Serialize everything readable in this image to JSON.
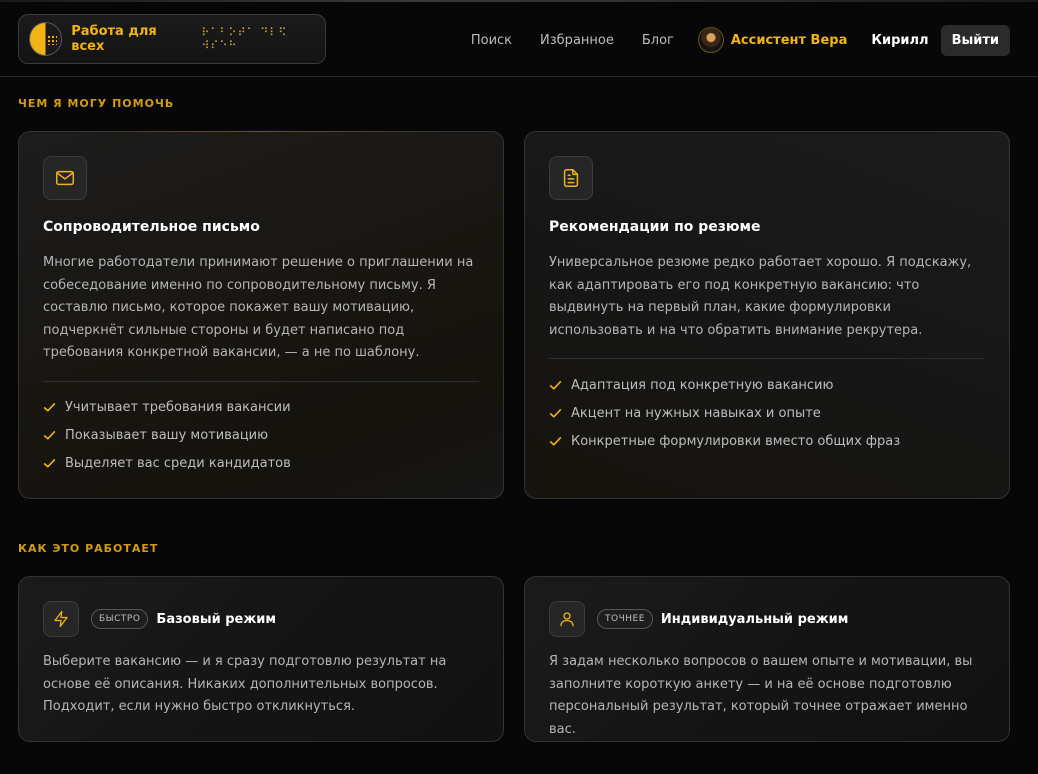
{
  "header": {
    "brand_title": "Работа для всех",
    "brand_braille": "⠗⠁⠃⠕⠞⠁ ⠙⠇⠫ ⠺⠎⠑⠓",
    "nav": [
      "Поиск",
      "Избранное",
      "Блог"
    ],
    "assistant_name": "Ассистент Вера",
    "user_name": "Кирилл",
    "logout_label": "Выйти"
  },
  "help_section": {
    "title": "ЧЕМ Я МОГУ ПОМОЧЬ",
    "cards": [
      {
        "icon": "mail-icon",
        "title": "Сопроводительное письмо",
        "text": "Многие работодатели принимают решение о приглашении на собеседование именно по сопроводительному письму. Я составлю письмо, которое покажет вашу мотивацию, подчеркнёт сильные стороны и будет написано под требования конкретной вакансии, — а не по шаблону.",
        "features": [
          "Учитывает требования вакансии",
          "Показывает вашу мотивацию",
          "Выделяет вас среди кандидатов"
        ]
      },
      {
        "icon": "document-icon",
        "title": "Рекомендации по резюме",
        "text": "Универсальное резюме редко работает хорошо. Я подскажу, как адаптировать его под конкретную вакансию: что выдвинуть на первый план, какие формулировки использовать и на что обратить внимание рекрутера.",
        "features": [
          "Адаптация под конкретную вакансию",
          "Акцент на нужных навыках и опыте",
          "Конкретные формулировки вместо общих фраз"
        ]
      }
    ]
  },
  "how_section": {
    "title": "КАК ЭТО РАБОТАЕТ",
    "modes": [
      {
        "icon": "lightning-icon",
        "badge": "БЫСТРО",
        "title": "Базовый режим",
        "text": "Выберите вакансию — и я сразу подготовлю результат на основе её описания. Никаких дополнительных вопросов. Подходит, если нужно быстро откликнуться."
      },
      {
        "icon": "user-icon",
        "badge": "ТОЧНЕЕ",
        "title": "Индивидуальный режим",
        "text": "Я задам несколько вопросов о вашем опыте и мотивации, вы заполните короткую анкету — и на её основе подготовлю персональный результат, который точнее отражает именно вас."
      }
    ]
  },
  "colors": {
    "accent": "#f2b316",
    "background": "#070707",
    "card": "#161616"
  }
}
